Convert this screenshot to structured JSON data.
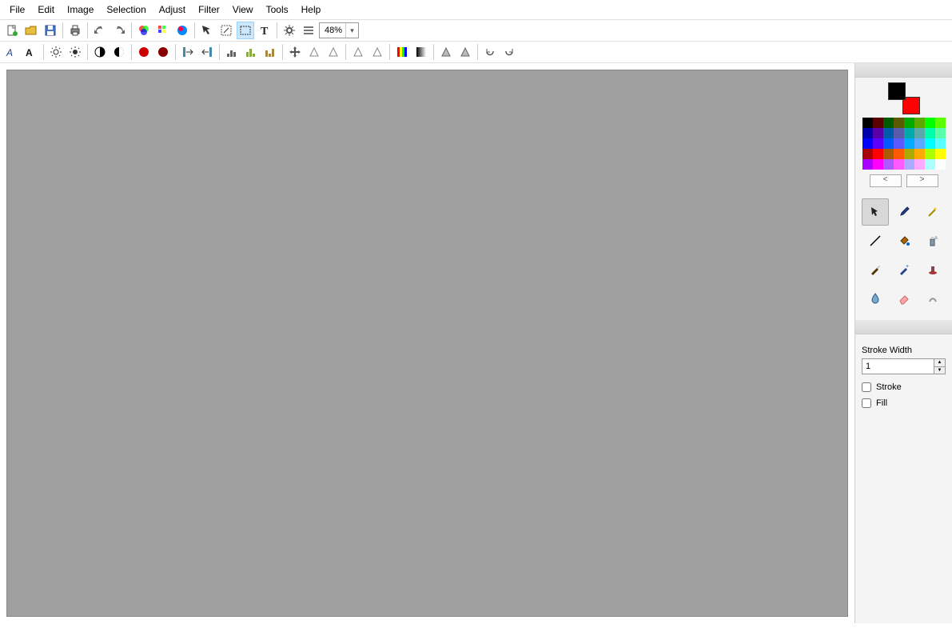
{
  "menu": [
    "File",
    "Edit",
    "Image",
    "Selection",
    "Adjust",
    "Filter",
    "View",
    "Tools",
    "Help"
  ],
  "zoom": "48%",
  "toolbar1": [
    {
      "n": "new-file-icon"
    },
    {
      "n": "open-file-icon"
    },
    {
      "n": "save-file-icon"
    },
    {
      "sep": true
    },
    {
      "n": "print-icon"
    },
    {
      "sep": true
    },
    {
      "n": "undo-icon"
    },
    {
      "n": "redo-icon"
    },
    {
      "sep": true
    },
    {
      "n": "rgb-channels-icon"
    },
    {
      "n": "palette-icon"
    },
    {
      "n": "color-wheel-icon"
    },
    {
      "sep": true
    },
    {
      "n": "arrow-tool-icon"
    },
    {
      "n": "wand-select-icon"
    },
    {
      "n": "rect-select-icon",
      "active": true
    },
    {
      "n": "text-tool-icon"
    },
    {
      "sep": true
    },
    {
      "n": "settings-icon"
    },
    {
      "n": "properties-icon"
    }
  ],
  "toolbar2": [
    {
      "n": "text-effect-a-icon"
    },
    {
      "n": "text-effect-b-icon"
    },
    {
      "sep": true
    },
    {
      "n": "brightness-up-icon"
    },
    {
      "n": "brightness-down-icon"
    },
    {
      "sep": true
    },
    {
      "n": "contrast-a-icon"
    },
    {
      "n": "contrast-b-icon"
    },
    {
      "sep": true
    },
    {
      "n": "red-circle-a-icon"
    },
    {
      "n": "red-circle-b-icon"
    },
    {
      "sep": true
    },
    {
      "n": "align-left-icon"
    },
    {
      "n": "align-right-icon"
    },
    {
      "sep": true
    },
    {
      "n": "histogram-a-icon"
    },
    {
      "n": "histogram-b-icon"
    },
    {
      "n": "histogram-c-icon"
    },
    {
      "sep": true
    },
    {
      "n": "move-icon"
    },
    {
      "n": "flip-a-icon"
    },
    {
      "n": "flip-b-icon"
    },
    {
      "sep": true
    },
    {
      "n": "flip-c-icon"
    },
    {
      "n": "flip-d-icon"
    },
    {
      "sep": true
    },
    {
      "n": "gradient-a-icon"
    },
    {
      "n": "gradient-b-icon"
    },
    {
      "sep": true
    },
    {
      "n": "shape-a-icon"
    },
    {
      "n": "shape-b-icon"
    },
    {
      "sep": true
    },
    {
      "n": "rotate-ccw-icon"
    },
    {
      "n": "rotate-cw-icon"
    }
  ],
  "colors": {
    "fg": "#000000",
    "bg": "#ff0000",
    "palette": [
      "#000000",
      "#5a0000",
      "#005a00",
      "#5a5a00",
      "#00aa00",
      "#5aaa00",
      "#00ff00",
      "#5aff00",
      "#0000aa",
      "#5a00aa",
      "#005aaa",
      "#5a5aaa",
      "#00aaaa",
      "#5aaaaa",
      "#00ffaa",
      "#5affaa",
      "#0000ff",
      "#5a00ff",
      "#005aff",
      "#5a5aff",
      "#00aaff",
      "#5aaaff",
      "#00ffff",
      "#5affff",
      "#aa0000",
      "#ff0000",
      "#aa5a00",
      "#ff5a00",
      "#aaaa00",
      "#ffaa00",
      "#aaff00",
      "#ffff00",
      "#aa00ff",
      "#ff00ff",
      "#aa5aff",
      "#ff5aff",
      "#aaaaff",
      "#ffaaff",
      "#aaffff",
      "#ffffff"
    ],
    "prev": "<",
    "next": ">"
  },
  "tools": [
    {
      "n": "pointer-tool",
      "sel": true
    },
    {
      "n": "eyedropper-tool"
    },
    {
      "n": "magic-wand-tool"
    },
    {
      "n": "line-tool"
    },
    {
      "n": "bucket-tool"
    },
    {
      "n": "spray-tool"
    },
    {
      "n": "brush-tool"
    },
    {
      "n": "clone-tool"
    },
    {
      "n": "stamp-tool"
    },
    {
      "n": "blur-tool"
    },
    {
      "n": "eraser-tool"
    },
    {
      "n": "smudge-tool"
    }
  ],
  "options": {
    "stroke_width_label": "Stroke Width",
    "stroke_width_value": "1",
    "stroke_label": "Stroke",
    "fill_label": "Fill"
  }
}
